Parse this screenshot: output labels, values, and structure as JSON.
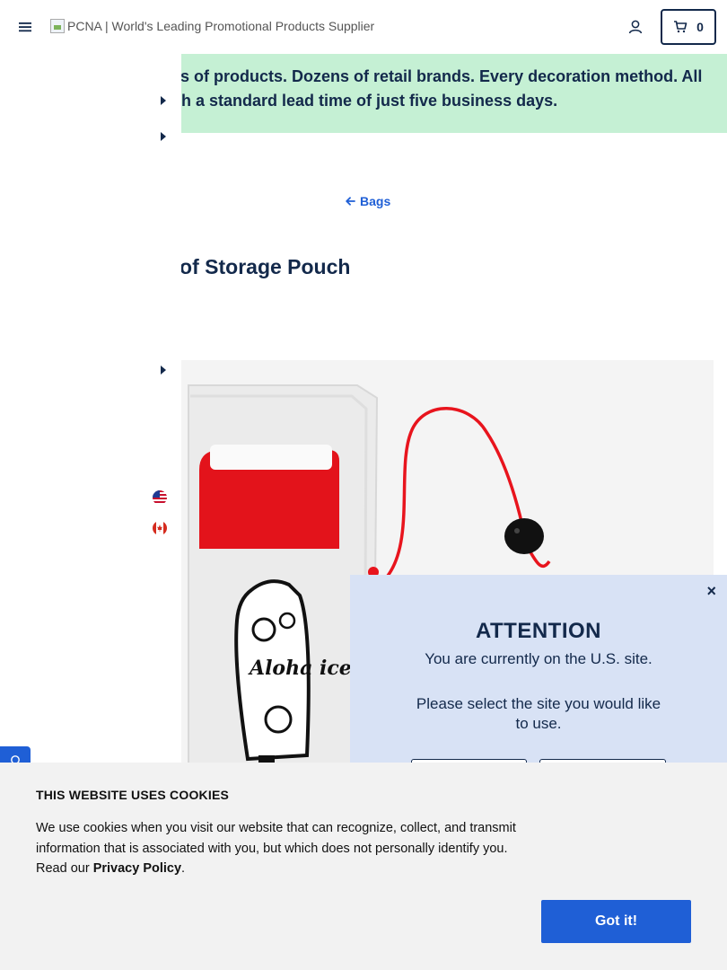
{
  "header": {
    "logo_alt": "PCNA | World's Leading Promotional Products Supplier",
    "cart_count": "0"
  },
  "banner": {
    "line1": "ls of products. Dozens of retail brands. Every decoration method. All",
    "line2": "th a standard lead time of just five business days."
  },
  "breadcrumb": {
    "back_label": "Bags"
  },
  "product": {
    "title": "oof Storage Pouch",
    "image_text": "Aloha ice"
  },
  "country_modal": {
    "title": "ATTENTION",
    "message": "You are currently on the U.S. site.",
    "prompt": "Please select the site you would like to use.",
    "close_label": "×"
  },
  "cookie_banner": {
    "title": "THIS WEBSITE USES COOKIES",
    "text_before": "We use cookies when you visit our website that can recognize, collect, and transmit information that is associated with you, but which does not personally identify you. Read our ",
    "link_label": "Privacy Policy",
    "text_after": ".",
    "button_label": "Got it!"
  },
  "colors": {
    "navy": "#13294b",
    "accent_blue": "#1f5fd6",
    "banner_green": "#c5f0d4",
    "modal_bg": "#d8e2f5",
    "cookie_bg": "#f2f2f2"
  },
  "icons": [
    "hamburger-menu-icon",
    "account-icon",
    "cart-icon",
    "arrow-left-icon",
    "caret-right-icon",
    "us-flag-icon",
    "canada-flag-icon",
    "chat-icon"
  ]
}
